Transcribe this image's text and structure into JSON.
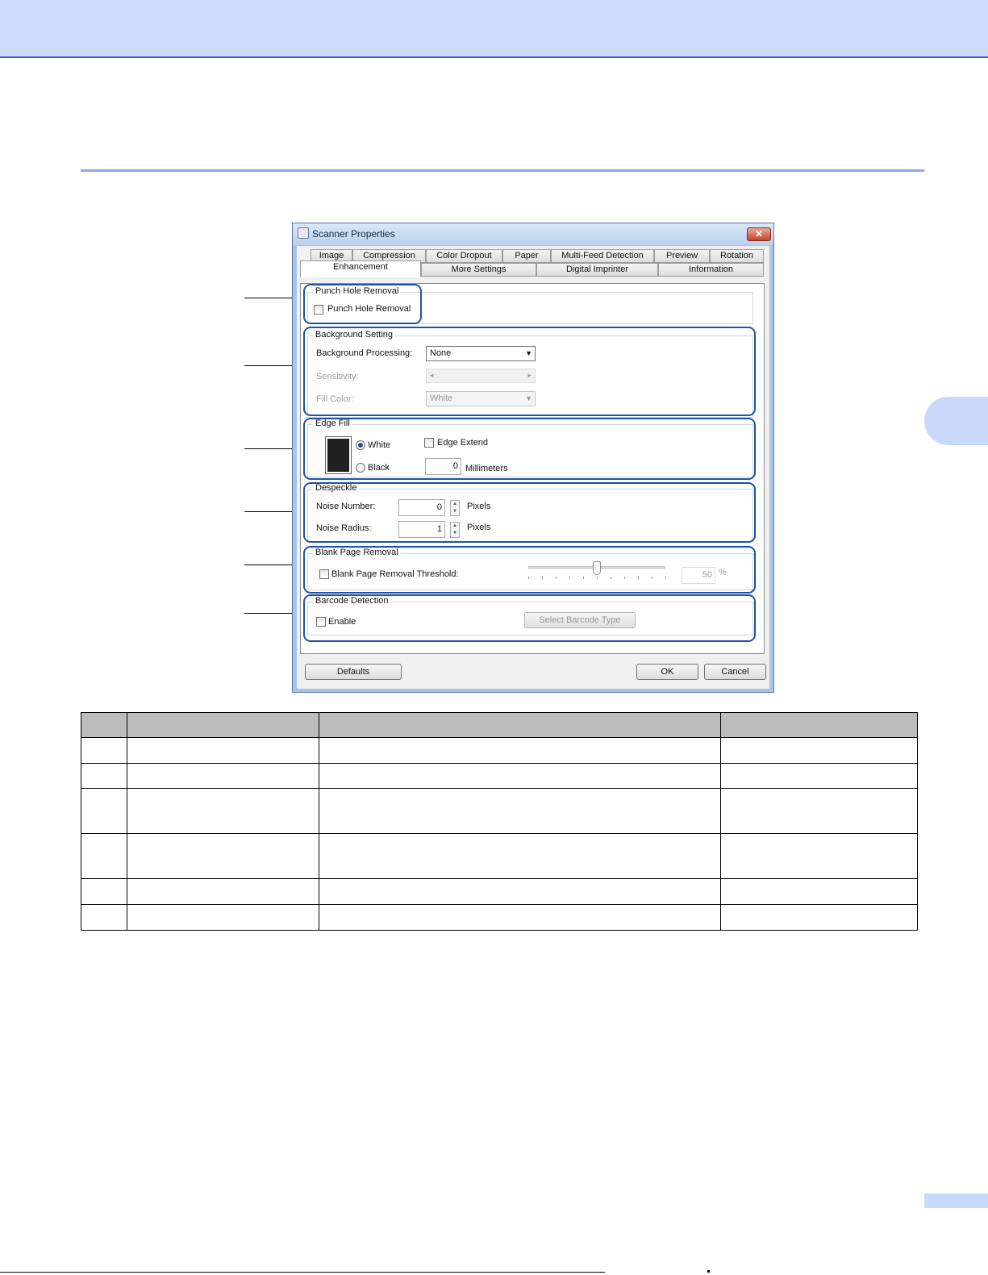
{
  "dialog": {
    "title": "Scanner Properties",
    "close_glyph": "✕",
    "tabs_row1": [
      "Image",
      "Compression",
      "Color Dropout",
      "Paper",
      "Multi-Feed Detection",
      "Preview",
      "Rotation"
    ],
    "tabs_row2": [
      "Enhancement",
      "More Settings",
      "Digital Imprinter",
      "Information"
    ],
    "active_tab": "Enhancement",
    "punch_hole": {
      "group_title": "Punch Hole Removal",
      "checkbox_label": "Punch Hole Removal",
      "checked": false
    },
    "background": {
      "group_title": "Background Setting",
      "processing_label": "Background Processing:",
      "processing_value": "None",
      "sensitivity_label": "Sensitivity:",
      "fill_color_label": "Fill Color:",
      "fill_color_value": "White"
    },
    "edge_fill": {
      "group_title": "Edge Fill",
      "white_label": "White",
      "black_label": "Black",
      "selected": "White",
      "edge_extend_label": "Edge Extend",
      "edge_extend_checked": false,
      "millimeters_value": "0",
      "millimeters_label": "Millimeters"
    },
    "despeckle": {
      "group_title": "Despeckle",
      "noise_number_label": "Noise Number:",
      "noise_number_value": "0",
      "noise_radius_label": "Noise Radius:",
      "noise_radius_value": "1",
      "unit_label_1": "Pixels",
      "unit_label_2": "Pixels"
    },
    "blank_page": {
      "group_title": "Blank Page Removal",
      "checkbox_label": "Blank Page Removal Threshold:",
      "checked": false,
      "threshold_value": "50",
      "threshold_unit": "%",
      "slider_fraction": 0.5
    },
    "barcode": {
      "group_title": "Barcode Detection",
      "enable_label": "Enable",
      "enable_checked": false,
      "select_type_label": "Select Barcode Type"
    },
    "buttons": {
      "defaults": "Defaults",
      "ok": "OK",
      "cancel": "Cancel"
    }
  },
  "table": {
    "header": [
      "",
      "",
      "",
      ""
    ],
    "rows": [
      [
        "",
        "",
        "",
        ""
      ],
      [
        "",
        "",
        "",
        ""
      ],
      [
        "",
        "",
        "",
        ""
      ],
      [
        "",
        "",
        "",
        ""
      ],
      [
        "",
        "",
        "",
        ""
      ],
      [
        "",
        "",
        "",
        ""
      ]
    ]
  },
  "colors": {
    "header_band": "#cddcfb",
    "accent_rule": "#8aa7ef",
    "callout_outline": "#1f53a7",
    "table_header": "#bdbdbd"
  }
}
